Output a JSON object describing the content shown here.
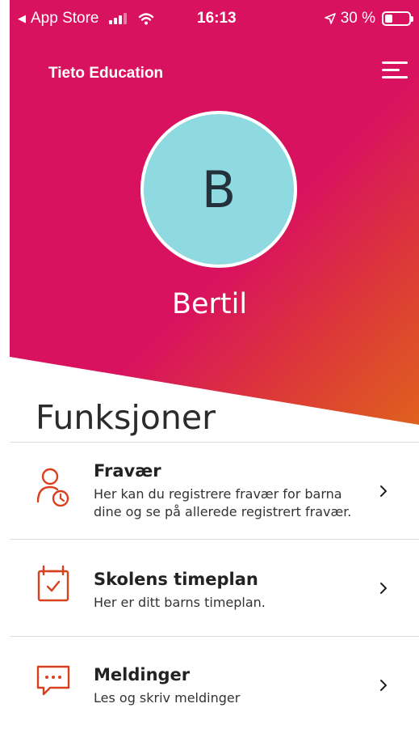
{
  "status_bar": {
    "back_app": "App Store",
    "time": "16:13",
    "battery": "30 %"
  },
  "header": {
    "brand": "Tieto Education"
  },
  "profile": {
    "initial": "B",
    "name": "Bertil",
    "avatar_color": "#8fd9e0"
  },
  "section": {
    "title": "Funksjoner"
  },
  "functions": [
    {
      "icon": "person-clock-icon",
      "title": "Fravær",
      "desc": "Her kan du registrere fravær for barna dine og se på allerede registrert fravær."
    },
    {
      "icon": "calendar-check-icon",
      "title": "Skolens timeplan",
      "desc": "Her er ditt barns timeplan."
    },
    {
      "icon": "chat-bubble-icon",
      "title": "Meldinger",
      "desc": "Les og skriv meldinger"
    }
  ],
  "colors": {
    "brand_pink": "#d9125f",
    "gradient_end": "#e0611e",
    "icon_accent": "#d9411e"
  }
}
